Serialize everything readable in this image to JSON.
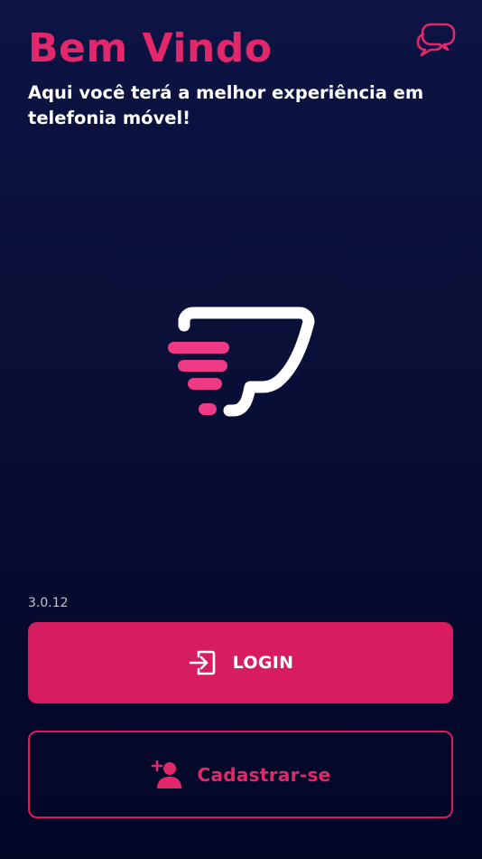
{
  "header": {
    "title": "Bem Vindo",
    "subtitle": "Aqui você terá a melhor experiência em telefonia móvel!",
    "chat_icon": "chat-bubbles-icon"
  },
  "logo": {
    "icon": "brand-t-logo"
  },
  "footer": {
    "version": "3.0.12",
    "login_label": "LOGIN",
    "login_icon": "login-enter-icon",
    "register_label": "Cadastrar-se",
    "register_icon": "add-user-icon"
  },
  "colors": {
    "background": "#0a1038",
    "accent": "#d81c62",
    "accent_text": "#e2276a",
    "text": "#ffffff",
    "muted": "#c2c4d0"
  }
}
